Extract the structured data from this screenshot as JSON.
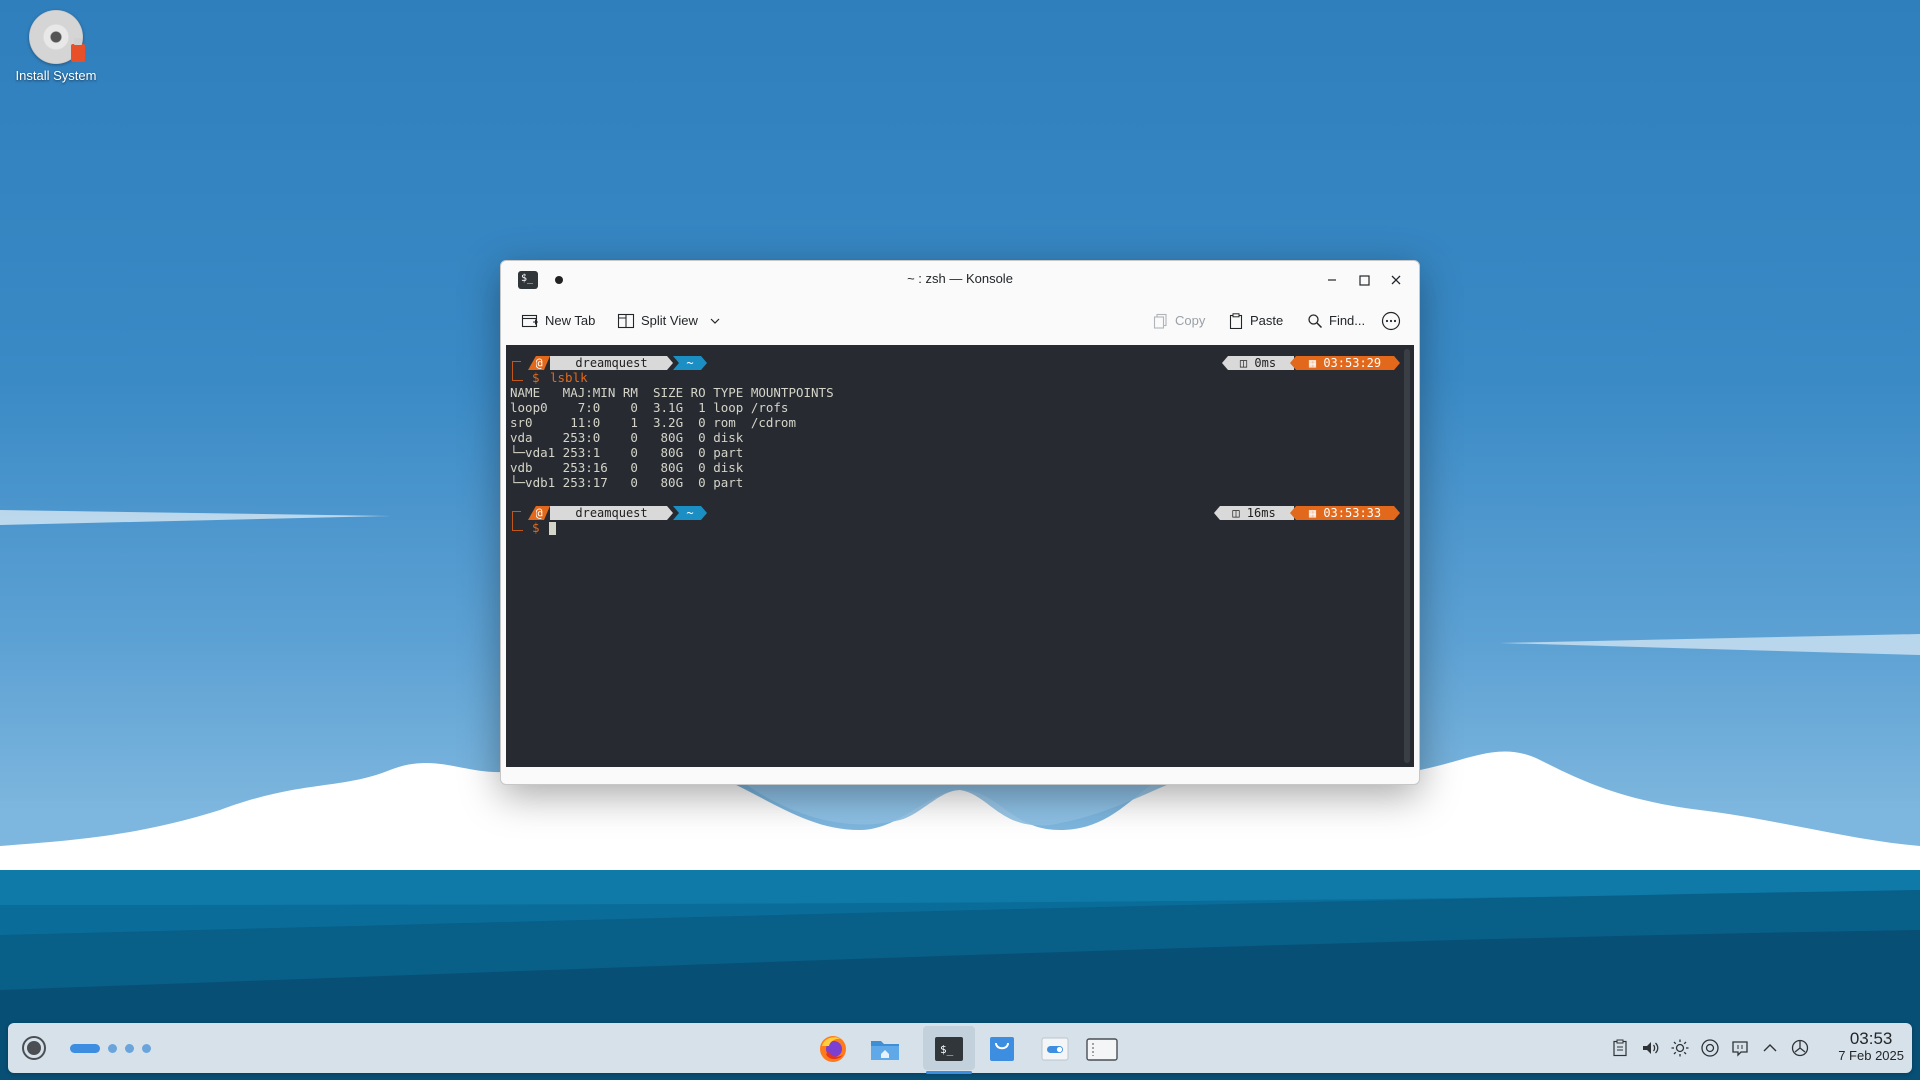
{
  "desktop": {
    "icon_label": "Install System"
  },
  "window": {
    "title": "~ : zsh — Konsole",
    "app_icon_glyph": "$_",
    "toolbar": {
      "new_tab": "New Tab",
      "split_view": "Split View",
      "copy": "Copy",
      "paste": "Paste",
      "find": "Find..."
    },
    "terminal": {
      "prompt1": {
        "icon": "@",
        "host": "dreamquest",
        "path": "~",
        "duration": "0ms",
        "time": "03:53:29"
      },
      "command1": "lsblk",
      "output": "NAME   MAJ:MIN RM  SIZE RO TYPE MOUNTPOINTS\nloop0    7:0    0  3.1G  1 loop /rofs\nsr0     11:0    1  3.2G  0 rom  /cdrom\nvda    253:0    0   80G  0 disk\n└─vda1 253:1    0   80G  0 part\nvdb    253:16   0   80G  0 disk\n└─vdb1 253:17   0   80G  0 part",
      "prompt2": {
        "icon": "@",
        "host": "dreamquest",
        "path": "~",
        "duration": "16ms",
        "time": "03:53:33"
      },
      "prompt_symbol": "$"
    }
  },
  "taskbar": {
    "apps": [
      "firefox-icon",
      "dolphin-icon",
      "konsole-icon",
      "discover-icon",
      "system-settings-icon",
      "window-icon"
    ],
    "tray": [
      "clipboard-icon",
      "volume-icon",
      "brightness-icon",
      "network-icon",
      "notifications-icon",
      "expand-tray-icon",
      "power-icon"
    ],
    "clock_time": "03:53",
    "clock_date": "7 Feb 2025"
  },
  "colors": {
    "accent": "#3d8ee0",
    "prompt_orange": "#e2681b",
    "prompt_blue": "#1b8fc4",
    "terminal_bg": "#272b31"
  }
}
